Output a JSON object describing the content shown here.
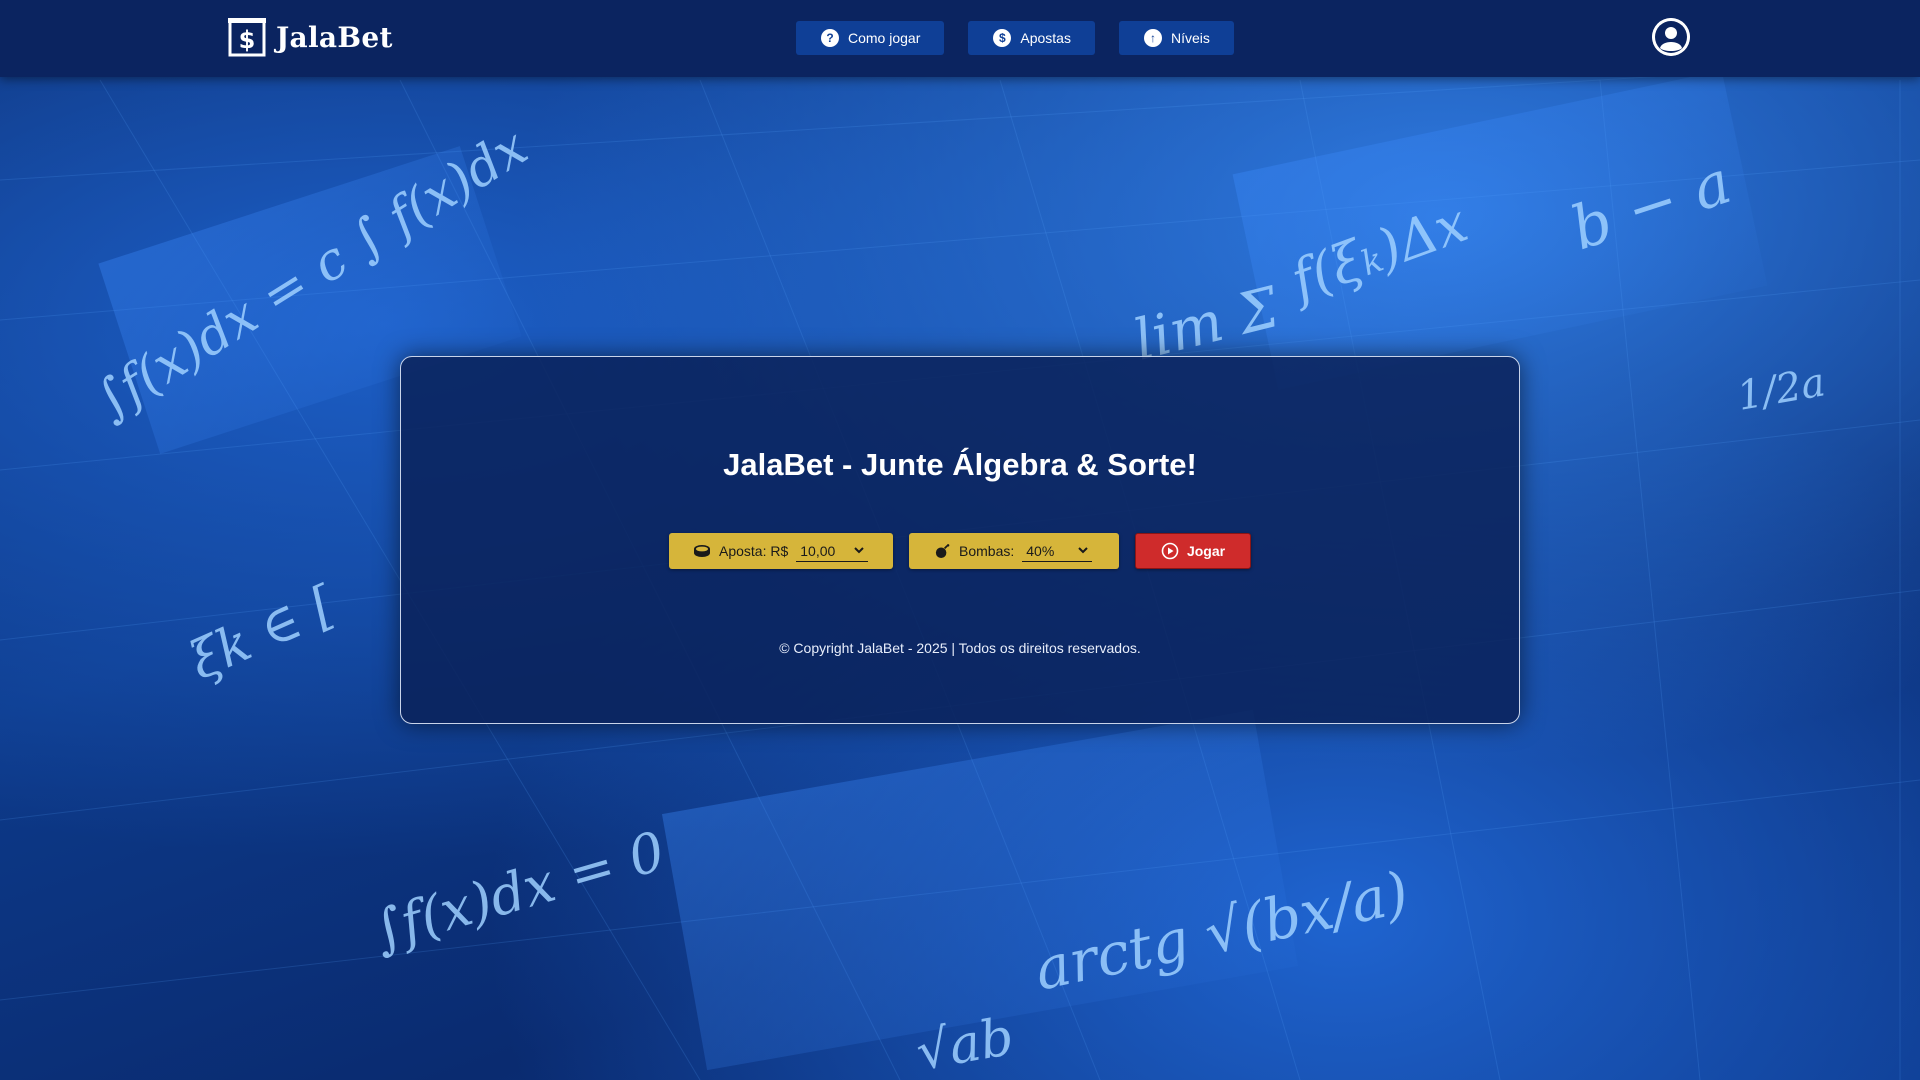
{
  "header": {
    "brand_name": "JalaBet",
    "nav": [
      {
        "label": "Como jogar",
        "icon": "question-icon"
      },
      {
        "label": "Apostas",
        "icon": "dollar-icon"
      },
      {
        "label": "Níveis",
        "icon": "arrow-up-icon"
      }
    ],
    "avatar_icon": "user-icon"
  },
  "panel": {
    "title": "JalaBet - Junte Álgebra & Sorte!",
    "aposta": {
      "label": "Aposta: R$",
      "value": "10,00",
      "icon": "coins-icon"
    },
    "bombas": {
      "label": "Bombas:",
      "value": "40%",
      "icon": "bomb-icon"
    },
    "play_label": "Jogar",
    "copyright": "© Copyright JalaBet - 2025 | Todos os direitos reservados."
  },
  "colors": {
    "header_bg": "#0b2460",
    "nav_button": "#0f3f96",
    "control_gold": "#d6b53a",
    "play_red": "#cf2b2b",
    "panel_bg": "#0b225a"
  }
}
